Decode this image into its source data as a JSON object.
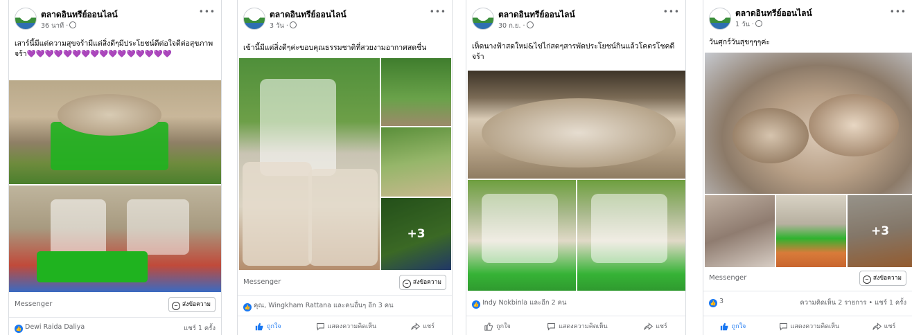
{
  "posts": [
    {
      "page_name": "ตลาดอินทรีย์ออนไลน์",
      "time": "36 นาที ·",
      "caption": "เสาร์นี้มีแต่ความสุขจร้ามีแต่สิ่งดีๆมีประโยชน์ดีต่อใจดีต่อสุขภาพจร้า💜💜💜💜💜💜💜💜💜💜💜💜💜💜💜💜",
      "messenger": "Messenger",
      "send_button": "ส่งข้อความ",
      "reaction_text": "Dewi Raida Daliya",
      "share_count": "แชร์ 1 ครั้ง"
    },
    {
      "page_name": "ตลาดอินทรีย์ออนไลน์",
      "time": "3 วัน ·",
      "caption": "เข้านี้มีแต่สิ่งดีๆค่ะขอบคุณธรรมชาติที่สวยงามอากาศสดชื่น",
      "more_photos": "+3",
      "messenger": "Messenger",
      "send_button": "ส่งข้อความ",
      "reaction_text": "คุณ, Wingkham Rattana และคนอื่นๆ อีก 3 คน",
      "like_label": "ถูกใจ",
      "comment_label": "แสดงความคิดเห็น",
      "share_label": "แชร์"
    },
    {
      "page_name": "ตลาดอินทรีย์ออนไลน์",
      "time": "30 ก.ย. ·",
      "caption": "เห็ดนางฟ้าสดใหม่&ไข่ไก่สดๆสารพัดประโยชน์กินแล้วโคตรโชคดีจร้า",
      "reaction_text": "Indy Nokbinla และอีก 2 คน",
      "like_label": "ถูกใจ",
      "comment_label": "แสดงความคิดเห็น",
      "share_label": "แชร์"
    },
    {
      "page_name": "ตลาดอินทรีย์ออนไลน์",
      "time": "1 วัน ·",
      "caption": "วันศุกร์วันสุขๆๆๆค่ะ",
      "more_photos": "+3",
      "messenger": "Messenger",
      "send_button": "ส่งข้อความ",
      "reaction_count": "3",
      "comments_shares": "ความคิดเห็น 2 รายการ • แชร์ 1 ครั้ง",
      "like_label": "ถูกใจ",
      "comment_label": "แสดงความคิดเห็น",
      "share_label": "แชร์"
    }
  ],
  "ui": {
    "more_icon": "more-options-icon",
    "globe_icon": "globe-icon",
    "like_icon": "thumbs-up-icon",
    "comment_icon": "comment-icon",
    "share_icon": "share-arrow-icon",
    "messenger_icon": "messenger-icon",
    "accent_color": "#1877f2"
  }
}
